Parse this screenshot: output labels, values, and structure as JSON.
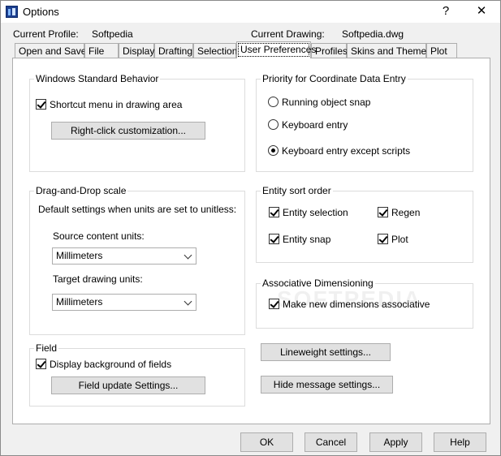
{
  "window": {
    "title": "Options",
    "help_glyph": "?",
    "close_glyph": "✕"
  },
  "profile": {
    "label": "Current Profile:",
    "value": "Softpedia"
  },
  "drawing": {
    "label": "Current Drawing:",
    "value": "Softpedia.dwg"
  },
  "tabs": [
    {
      "label": "Open and Save"
    },
    {
      "label": "File"
    },
    {
      "label": "Display"
    },
    {
      "label": "Drafting"
    },
    {
      "label": "Selection"
    },
    {
      "label": "User Preferences",
      "active": true
    },
    {
      "label": "Profiles"
    },
    {
      "label": "Skins and Themes"
    },
    {
      "label": "Plot"
    }
  ],
  "windows_behavior": {
    "title": "Windows Standard Behavior",
    "shortcut_label": "Shortcut menu in drawing area",
    "shortcut_checked": true,
    "right_click_button": "Right-click customization..."
  },
  "drag_drop": {
    "title": "Drag-and-Drop scale",
    "description": "Default settings when units are set to unitless:",
    "source_label": "Source content units:",
    "source_value": "Millimeters",
    "target_label": "Target drawing units:",
    "target_value": "Millimeters"
  },
  "field": {
    "title": "Field",
    "display_label": "Display background of fields",
    "display_checked": true,
    "update_button": "Field update Settings..."
  },
  "priority": {
    "title": "Priority for Coordinate Data Entry",
    "options": [
      {
        "label": "Running object snap",
        "selected": false
      },
      {
        "label": "Keyboard entry",
        "selected": false
      },
      {
        "label": "Keyboard entry except scripts",
        "selected": true
      }
    ]
  },
  "sort_order": {
    "title": "Entity sort order",
    "items": [
      {
        "label": "Entity selection",
        "checked": true
      },
      {
        "label": "Regen",
        "checked": true
      },
      {
        "label": "Entity snap",
        "checked": true
      },
      {
        "label": "Plot",
        "checked": true
      }
    ]
  },
  "assoc": {
    "title": "Associative Dimensioning",
    "make_label": "Make new dimensions associative",
    "make_checked": true
  },
  "buttons": {
    "lineweight": "Lineweight settings...",
    "hide_message": "Hide message settings...",
    "ok": "OK",
    "cancel": "Cancel",
    "apply": "Apply",
    "help": "Help"
  }
}
